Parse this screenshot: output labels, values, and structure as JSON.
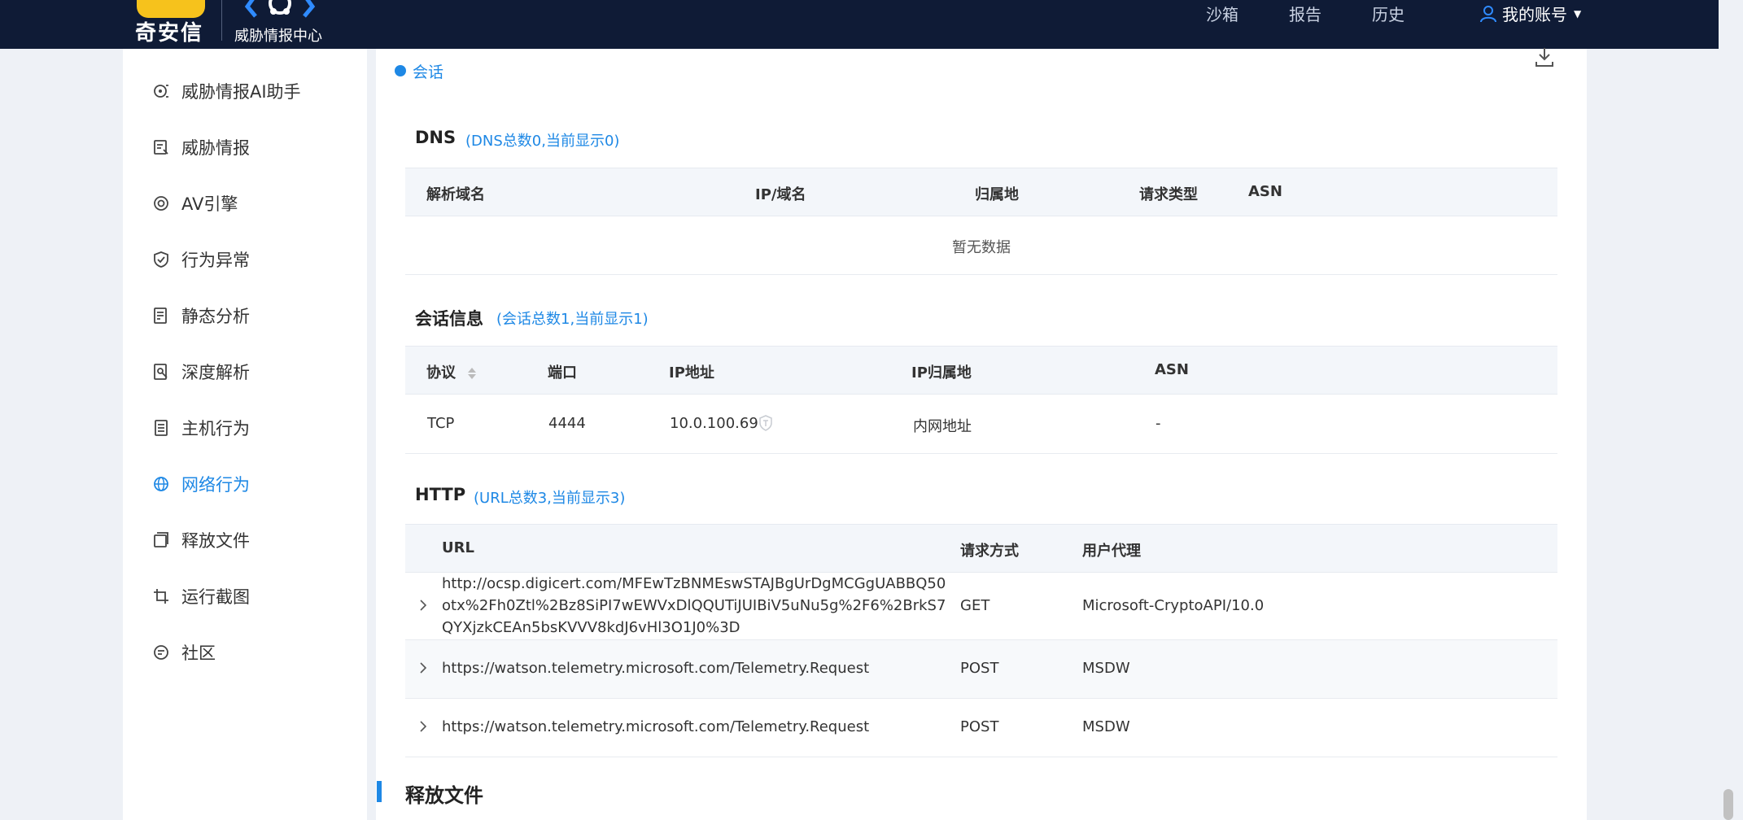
{
  "header": {
    "brand_name": "奇安信",
    "brand_sub": "威胁情报中心",
    "nav": [
      "沙箱",
      "报告",
      "历史"
    ],
    "account": "我的账号"
  },
  "sidebar": {
    "items": [
      {
        "label": "威胁情报AI助手",
        "icon": "ai-assistant-icon",
        "active": false
      },
      {
        "label": "威胁情报",
        "icon": "intel-icon",
        "active": false
      },
      {
        "label": "AV引擎",
        "icon": "target-icon",
        "active": false
      },
      {
        "label": "行为异常",
        "icon": "shield-icon",
        "active": false
      },
      {
        "label": "静态分析",
        "icon": "static-analysis-icon",
        "active": false
      },
      {
        "label": "深度解析",
        "icon": "deep-analysis-icon",
        "active": false
      },
      {
        "label": "主机行为",
        "icon": "host-icon",
        "active": false
      },
      {
        "label": "网络行为",
        "icon": "globe-icon",
        "active": true
      },
      {
        "label": "释放文件",
        "icon": "files-icon",
        "active": false
      },
      {
        "label": "运行截图",
        "icon": "crop-icon",
        "active": false
      },
      {
        "label": "社区",
        "icon": "chat-icon",
        "active": false
      }
    ]
  },
  "main": {
    "session_tab": "会话",
    "dns": {
      "title": "DNS",
      "count": "(DNS总数0,当前显示0)",
      "columns": [
        "解析域名",
        "IP/域名",
        "归属地",
        "请求类型",
        "ASN"
      ],
      "empty": "暂无数据"
    },
    "sessions": {
      "title": "会话信息",
      "count": "(会话总数1,当前显示1)",
      "columns": [
        "协议",
        "端口",
        "IP地址",
        "IP归属地",
        "ASN"
      ],
      "rows": [
        {
          "protocol": "TCP",
          "port": "4444",
          "ip": "10.0.100.69",
          "location": "内网地址",
          "asn": "-"
        }
      ]
    },
    "http": {
      "title": "HTTP",
      "count": "(URL总数3,当前显示3)",
      "columns": [
        "URL",
        "请求方式",
        "用户代理"
      ],
      "rows": [
        {
          "url": [
            "http://ocsp.digicert.com/MFEwTzBNMEswSTAJBgUrDgMCGgUABBQ50",
            "otx%2Fh0Ztl%2Bz8SiPI7wEWVxDlQQUTiJUIBiV5uNu5g%2F6%2BrkS7",
            "QYXjzkCEAn5bsKVVV8kdJ6vHl3O1J0%3D"
          ],
          "method": "GET",
          "agent": "Microsoft-CryptoAPI/10.0"
        },
        {
          "url": [
            "https://watson.telemetry.microsoft.com/Telemetry.Request"
          ],
          "method": "POST",
          "agent": "MSDW"
        },
        {
          "url": [
            "https://watson.telemetry.microsoft.com/Telemetry.Request"
          ],
          "method": "POST",
          "agent": "MSDW"
        }
      ]
    },
    "release_title": "释放文件"
  },
  "colors": {
    "topbar": "#0f1b36",
    "accent": "#1e88e5",
    "brand_yellow": "#f6c21c"
  }
}
